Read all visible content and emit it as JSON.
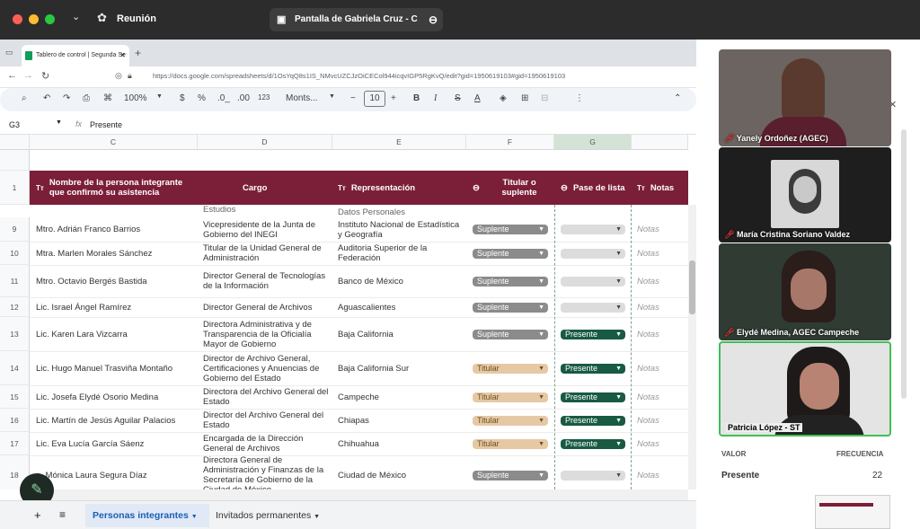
{
  "mac": {
    "meeting": "Reunión",
    "share": "Pantalla de Gabriela Cruz - C"
  },
  "browser": {
    "tab": "Tablero de control | Segunda Se",
    "url": "https://docs.google.com/spreadsheets/d/1OsYqQ8s1IS_NMvcUZCJzOiCECol944icqvIGP5RgKvQ/edit?gid=1950619103#gid=1950619103"
  },
  "toolbar": {
    "zoom": "100%",
    "currency": "$",
    "percent": "%",
    "dec_less": ".0_",
    "dec_more": ".00",
    "num_fmt": "123",
    "font": "Monts...",
    "size": "10",
    "bold": "B",
    "italic": "I",
    "strike": "S",
    "color": "A"
  },
  "fx": {
    "ref": "G3",
    "value": "Presente"
  },
  "cols": [
    "C",
    "D",
    "E",
    "F",
    "G"
  ],
  "headers": {
    "name": "Nombre de la persona integrante que confirmó su asistencia",
    "cargo": "Cargo",
    "rep": "Representación",
    "tit": "Titular o suplente",
    "pase": "Pase de lista",
    "notas": "Notas"
  },
  "row_above": {
    "cargo": "Estudios",
    "rep": "Datos Personales"
  },
  "rows": [
    {
      "n": "9",
      "name": "Mtro. Adrián Franco Barrios",
      "cargo": "Vicepresidente de la Junta de Gobierno del INEGI",
      "rep": "Instituto Nacional de Estadística y Geografía",
      "tit": "Suplente",
      "pase": "",
      "notas": "Notas"
    },
    {
      "n": "10",
      "name": "Mtra. Marlen Morales Sánchez",
      "cargo": "Titular de la Unidad General de Administración",
      "rep": "Auditoria Superior de la Federación",
      "tit": "Suplente",
      "pase": "",
      "notas": "Notas"
    },
    {
      "n": "11",
      "name": "Mtro. Octavio Bergés Bastida",
      "cargo": "Director General de Tecnologías de la Información",
      "rep": "Banco de México",
      "tit": "Suplente",
      "pase": "",
      "notas": "Notas"
    },
    {
      "n": "12",
      "name": "Lic. Israel Ángel Ramírez",
      "cargo": "Director General de Archivos",
      "rep": "Aguascalientes",
      "tit": "Suplente",
      "pase": "",
      "notas": "Notas"
    },
    {
      "n": "13",
      "name": "Lic. Karen Lara Vizcarra",
      "cargo": "Directora Administrativa y de Transparencia de la Oficialía Mayor de Gobierno",
      "rep": "Baja California",
      "tit": "Suplente",
      "pase": "Presente",
      "notas": "Notas"
    },
    {
      "n": "14",
      "name": "Lic. Hugo Manuel Trasviña Montaño",
      "cargo": "Director de Archivo General, Certificaciones y Anuencias de Gobierno del Estado",
      "rep": "Baja California Sur",
      "tit": "Titular",
      "pase": "Presente",
      "notas": "Notas"
    },
    {
      "n": "15",
      "name": "Lic. Josefa Elydé Osorio Medina",
      "cargo": "Directora del Archivo General del Estado",
      "rep": "Campeche",
      "tit": "Titular",
      "pase": "Presente",
      "notas": "Notas"
    },
    {
      "n": "16",
      "name": "Lic. Martín de Jesús Aguilar Palacios",
      "cargo": "Director del Archivo General del Estado",
      "rep": "Chiapas",
      "tit": "Titular",
      "pase": "Presente",
      "notas": "Notas"
    },
    {
      "n": "17",
      "name": "Lic. Eva Lucía García Sáenz",
      "cargo": "Encargada de la Dirección General de Archivos",
      "rep": "Chihuahua",
      "tit": "Titular",
      "pase": "Presente",
      "notas": "Notas"
    },
    {
      "n": "18",
      "name": "a. Mónica Laura Segura Díaz",
      "cargo": "Directora General de Administración y Finanzas de la Secretaría de Gobierno de la Ciudad de México",
      "rep": "Ciudad de México",
      "tit": "Suplente",
      "pase": "",
      "notas": "Notas"
    }
  ],
  "sheets": {
    "active": "Personas integrantes",
    "other": "Invitados permanentes"
  },
  "participants": [
    "Yanely Ordoñez (AGEC)",
    "María Cristina Soriano Valdez",
    "Elydé Medina, AGEC Campeche",
    "Patricia López - ST"
  ],
  "panel": {
    "col1": "VALOR",
    "col2": "FRECUENCIA",
    "value": "Presente",
    "freq": "22"
  }
}
